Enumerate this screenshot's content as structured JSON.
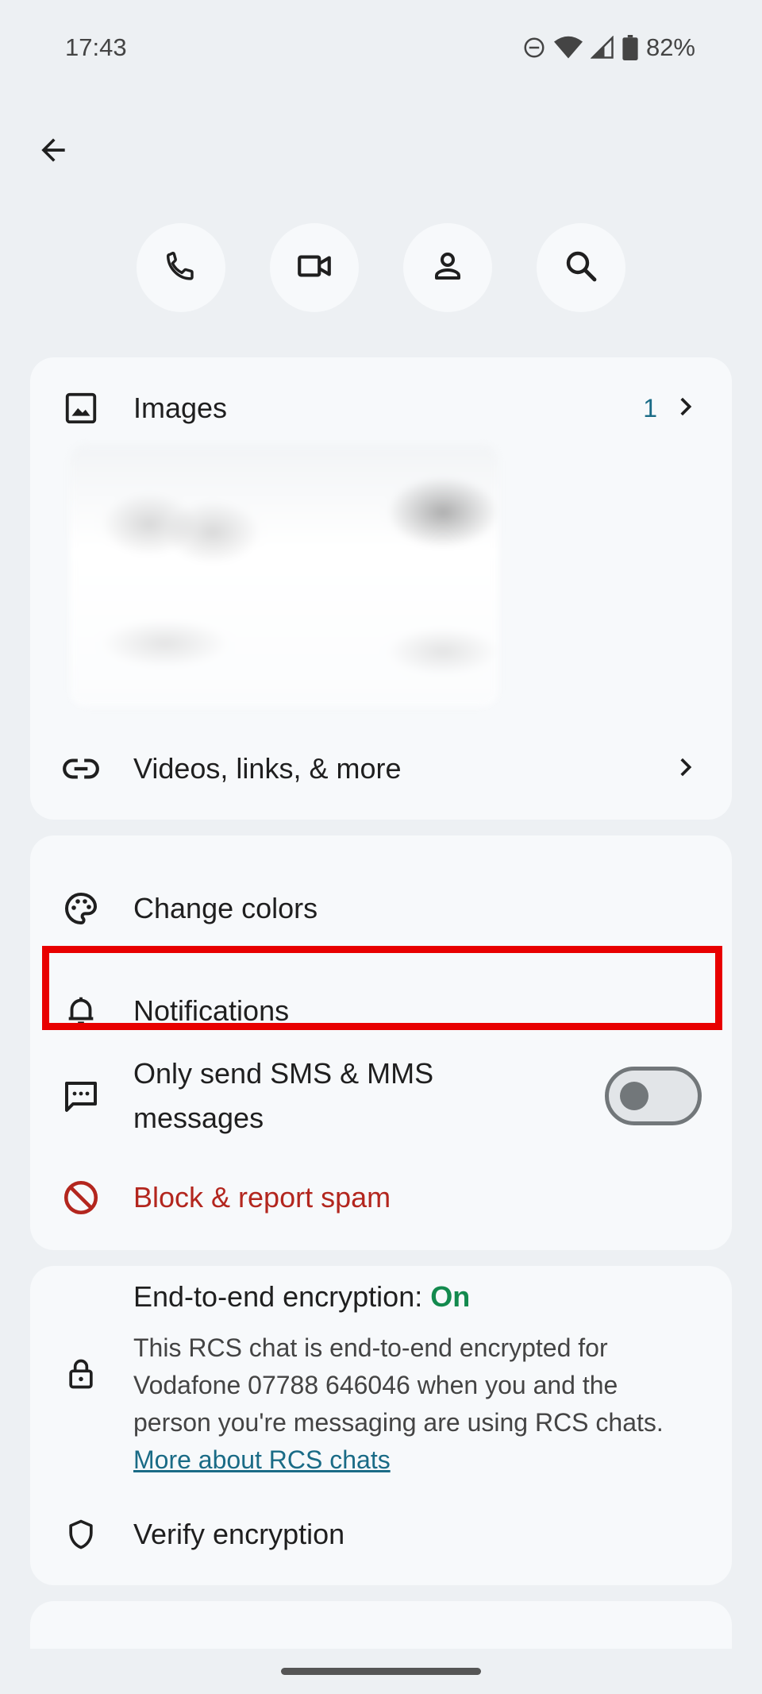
{
  "status_bar": {
    "time": "17:43",
    "battery": "82%",
    "icons": [
      "dnd-icon",
      "wifi-icon",
      "signal-icon",
      "battery-icon"
    ]
  },
  "header": {
    "back_icon": "arrow-back-icon"
  },
  "quick_actions": [
    {
      "name": "call-button",
      "icon": "phone-icon"
    },
    {
      "name": "video-call-button",
      "icon": "video-camera-icon"
    },
    {
      "name": "contact-button",
      "icon": "person-icon"
    },
    {
      "name": "search-button",
      "icon": "search-icon"
    }
  ],
  "media": {
    "images_label": "Images",
    "images_count": "1",
    "videos_label": "Videos, links, & more"
  },
  "settings": {
    "change_colors": "Change colors",
    "notifications": "Notifications",
    "sms_only": "Only send SMS & MMS messages",
    "sms_only_enabled": false,
    "block": "Block & report spam"
  },
  "encryption": {
    "title": "End-to-end encryption: ",
    "status": "On",
    "description": "This RCS chat is end-to-end encrypted for Vodafone 07788 646046 when you and the person you're messaging are using RCS chats.",
    "link": "More about RCS chats",
    "verify": "Verify encryption"
  },
  "colors": {
    "background": "#edf0f3",
    "card": "#f7f9fb",
    "accent_teal": "#1a6b86",
    "on_green": "#138a4e",
    "danger_red": "#b3261e",
    "highlight_red": "#e80000"
  }
}
